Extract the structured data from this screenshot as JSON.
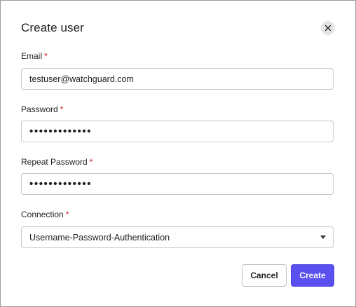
{
  "dialog": {
    "title": "Create user",
    "close_icon": "close-icon"
  },
  "fields": {
    "email": {
      "label": "Email",
      "required": "*",
      "value": "testuser@watchguard.com"
    },
    "password": {
      "label": "Password",
      "required": "*",
      "value": "•••••••••••••"
    },
    "repeat_password": {
      "label": "Repeat Password",
      "required": "*",
      "value": "•••••••••••••"
    },
    "connection": {
      "label": "Connection",
      "required": "*",
      "value": "Username-Password-Authentication",
      "icon": "chevron-down-icon"
    }
  },
  "actions": {
    "cancel_label": "Cancel",
    "create_label": "Create"
  },
  "colors": {
    "accent": "#5a50f0",
    "required": "#d11a2a",
    "border": "#c7c7c7"
  }
}
